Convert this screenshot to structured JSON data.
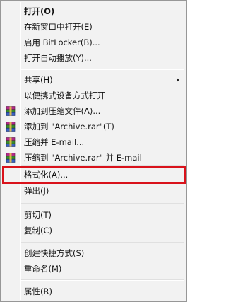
{
  "menu": {
    "items": [
      {
        "label": "打开(O)"
      },
      {
        "label": "在新窗口中打开(E)"
      },
      {
        "label": "启用 BitLocker(B)..."
      },
      {
        "label": "打开自动播放(Y)..."
      },
      {
        "label": "共享(H)"
      },
      {
        "label": "以便携式设备方式打开"
      },
      {
        "label": "添加到压缩文件(A)..."
      },
      {
        "label": "添加到 \"Archive.rar\"(T)"
      },
      {
        "label": "压缩并 E-mail..."
      },
      {
        "label": "压缩到 \"Archive.rar\" 并 E-mail"
      },
      {
        "label": "格式化(A)..."
      },
      {
        "label": "弹出(J)"
      },
      {
        "label": "剪切(T)"
      },
      {
        "label": "复制(C)"
      },
      {
        "label": "创建快捷方式(S)"
      },
      {
        "label": "重命名(M)"
      },
      {
        "label": "属性(R)"
      }
    ]
  },
  "icons": {
    "archive": "winrar-archive-icon"
  },
  "colors": {
    "menu_bg": "#f2f2f2",
    "highlight_border": "#d9121b"
  }
}
